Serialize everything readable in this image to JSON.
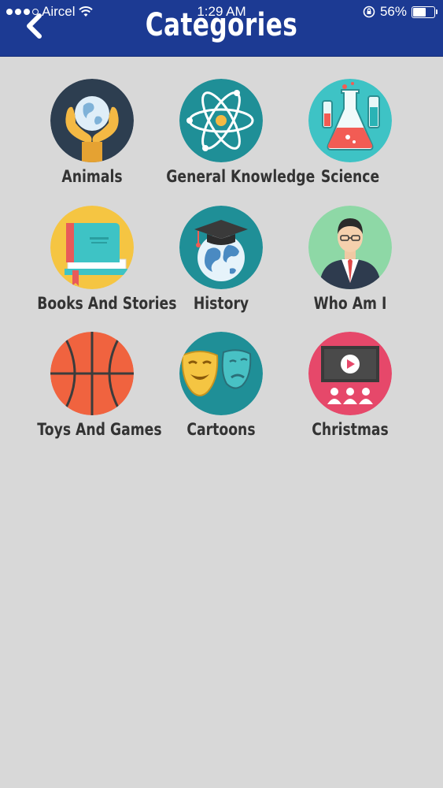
{
  "status_bar": {
    "carrier": "Aircel",
    "time": "1:29 AM",
    "battery_percent": "56%",
    "battery_level": 0.56
  },
  "header": {
    "title": "Categories",
    "back_icon": "chevron-left-icon",
    "background_color": "#1c3a93"
  },
  "categories": [
    {
      "label": "Animals",
      "icon": "globe-in-hands-icon"
    },
    {
      "label": "General Knowledge",
      "icon": "atom-icon"
    },
    {
      "label": "Science",
      "icon": "lab-flask-icon"
    },
    {
      "label": "Books And Stories",
      "icon": "book-icon"
    },
    {
      "label": "History",
      "icon": "globe-graduation-cap-icon"
    },
    {
      "label": "Who Am I",
      "icon": "businessman-icon"
    },
    {
      "label": "Toys And Games",
      "icon": "basketball-icon"
    },
    {
      "label": "Cartoons",
      "icon": "theater-masks-icon"
    },
    {
      "label": "Christmas",
      "icon": "cinema-screen-icon"
    }
  ]
}
